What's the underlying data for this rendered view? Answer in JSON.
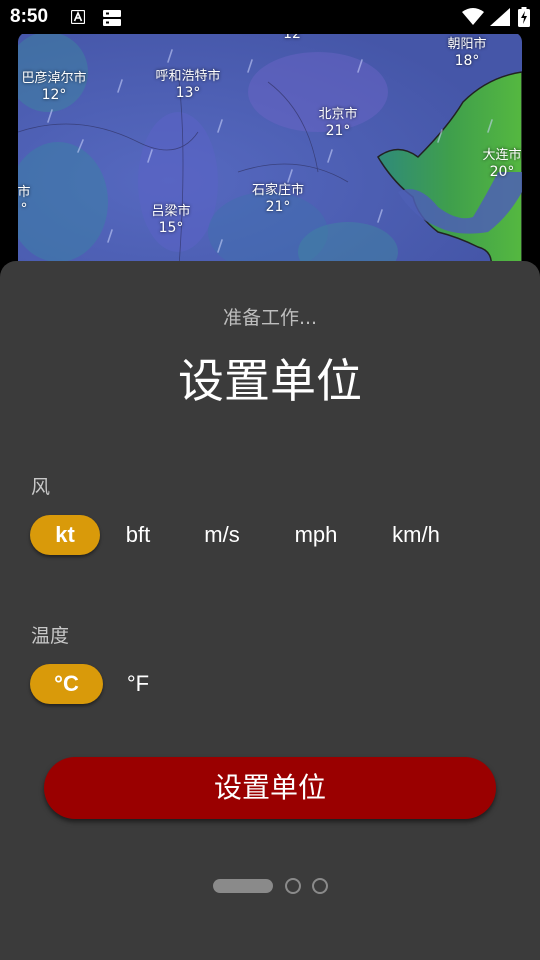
{
  "status_bar": {
    "time": "8:50",
    "icons": [
      "a-notification-icon",
      "sim-card-icon",
      "wifi-icon",
      "signal-icon",
      "battery-charging-icon"
    ]
  },
  "map": {
    "cities": [
      {
        "name": "巴彦淖尔市",
        "temp": "12°"
      },
      {
        "name": "呼和浩特市",
        "temp": "13°"
      },
      {
        "name": "朝阳市",
        "temp": "18°"
      },
      {
        "name": "北京市",
        "temp": "21°"
      },
      {
        "name": "大连市",
        "temp": "20°"
      },
      {
        "name": "石家庄市",
        "temp": "21°"
      },
      {
        "name": "吕梁市",
        "temp": "15°"
      },
      {
        "name": "市",
        "temp": "°"
      },
      {
        "name": "",
        "temp": "12"
      }
    ]
  },
  "sheet": {
    "subtitle": "准备工作...",
    "title": "设置单位",
    "wind": {
      "label": "风",
      "options": [
        "kt",
        "bft",
        "m/s",
        "mph",
        "km/h"
      ],
      "selected": "kt"
    },
    "temperature": {
      "label": "温度",
      "options": [
        "°C",
        "°F"
      ],
      "selected": "°C"
    },
    "button_label": "设置单位",
    "pager": {
      "total": 3,
      "current": 1
    }
  },
  "colors": {
    "sheet_bg": "#3b3b3b",
    "selected_chip": "#d99a0a",
    "primary_button": "#9a0000",
    "map_water": "#4a5cb0",
    "map_land": "#3aa04a"
  }
}
